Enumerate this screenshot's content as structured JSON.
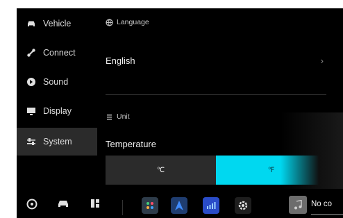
{
  "sidebar": {
    "items": [
      {
        "label": "Vehicle",
        "icon": "car-icon"
      },
      {
        "label": "Connect",
        "icon": "connect-icon"
      },
      {
        "label": "Sound",
        "icon": "speaker-icon"
      },
      {
        "label": "Display",
        "icon": "monitor-icon"
      },
      {
        "label": "System",
        "icon": "sliders-icon",
        "active": true
      }
    ]
  },
  "language": {
    "heading": "Language",
    "value": "English",
    "chevron": "›"
  },
  "unit": {
    "heading": "Unit",
    "temperature_label": "Temperature",
    "options": [
      "℃",
      "℉"
    ],
    "selected": "℉"
  },
  "dock": {
    "media_text": "No co",
    "apps": [
      "settings-app-icon",
      "navigation-app-icon",
      "media-app-icon",
      "gear-app-icon",
      "music-icon"
    ]
  },
  "colors": {
    "accent": "#00d8f0",
    "background": "#000000",
    "active_item": "#2b2b2b"
  }
}
